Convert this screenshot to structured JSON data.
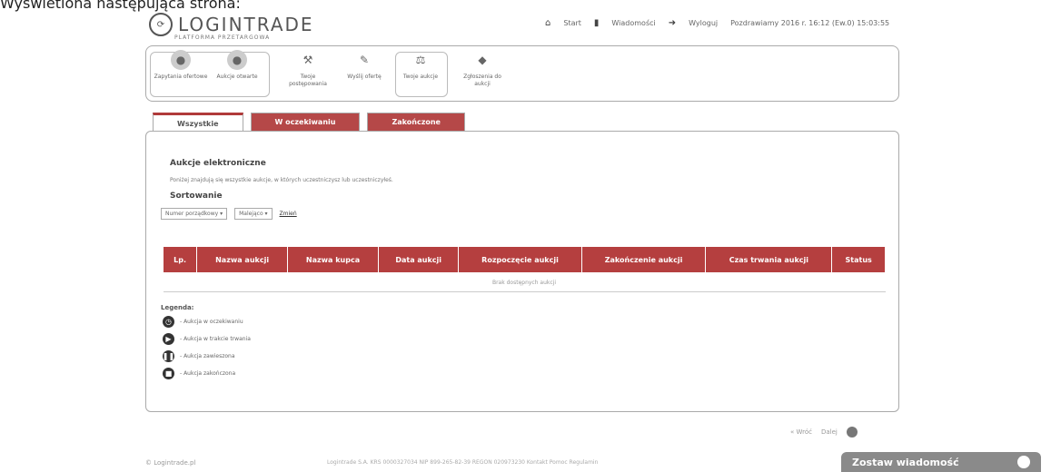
{
  "caption": "Wyświetlona następująca strona:",
  "logo": {
    "text": "LOGINTRADE",
    "subtitle": "PLATFORMA PRZETARGOWA"
  },
  "topbar": {
    "start": "Start",
    "messages": "Wiadomości",
    "logout": "Wyloguj",
    "info": "Pozdrawiamy 2016 r. 16:12 (Ew.0) 15:03:55"
  },
  "toolbar": {
    "items": [
      {
        "label": "Zapytania ofertowe",
        "icon": "briefcase-icon"
      },
      {
        "label": "Aukcje otwarte",
        "icon": "auction-icon"
      },
      {
        "label": "Twoje postępowania",
        "icon": "hammer-icon"
      },
      {
        "label": "Wyślij ofertę",
        "icon": "send-icon"
      },
      {
        "label": "Twoje aukcje",
        "icon": "gavel-icon"
      },
      {
        "label": "Zgłoszenia do aukcji",
        "icon": "tag-icon"
      }
    ]
  },
  "tabs": [
    {
      "label": "Wszystkie",
      "active": true
    },
    {
      "label": "W oczekiwaniu",
      "active": false
    },
    {
      "label": "Zakończone",
      "active": false
    }
  ],
  "panel": {
    "heading": "Aukcje elektroniczne",
    "description": "Poniżej znajdują się wszystkie aukcje, w których uczestniczysz lub uczestniczyłeś.",
    "sort_label": "Sortowanie",
    "sort_field": "Numer porządkowy",
    "sort_order": "Malejąco",
    "change_link": "Zmień"
  },
  "table": {
    "columns": [
      "Lp.",
      "Nazwa aukcji",
      "Nazwa kupca",
      "Data aukcji",
      "Rozpoczęcie aukcji",
      "Zakończenie aukcji",
      "Czas trwania aukcji",
      "Status"
    ],
    "empty_text": "Brak dostępnych aukcji"
  },
  "legend": {
    "title": "Legenda:",
    "items": [
      {
        "label": "- Aukcja w oczekiwaniu",
        "icon": "clock-icon"
      },
      {
        "label": "- Aukcja w trakcie trwania",
        "icon": "play-icon"
      },
      {
        "label": "- Aukcja zawieszona",
        "icon": "pause-icon"
      },
      {
        "label": "- Aukcja zakończona",
        "icon": "stop-icon"
      }
    ]
  },
  "pager": {
    "prev": "« Wróć",
    "next": "Dalej"
  },
  "footer": {
    "brand": "© Logintrade.pl",
    "info": "Logintrade S.A. KRS 0000327034 NIP 899-265-82-39 REGON 020973230 Kontakt Pomoc Regulamin"
  },
  "message_button": "Zostaw wiadomość"
}
